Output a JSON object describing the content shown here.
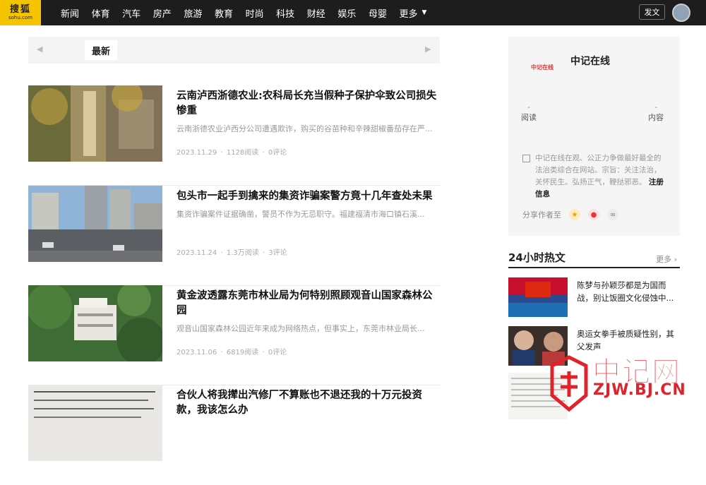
{
  "brand": {
    "logo_line1": "搜狐",
    "logo_line2": "sohu.com"
  },
  "nav": {
    "items": [
      "新闻",
      "体育",
      "汽车",
      "房产",
      "旅游",
      "教育",
      "时尚",
      "科技",
      "财经",
      "娱乐",
      "母婴"
    ],
    "more_label": "更多",
    "publish_label": "发文"
  },
  "tabs": {
    "active": "最新"
  },
  "articles": [
    {
      "title": "云南泸西浙德农业:农科局长充当假种子保护伞致公司损失惨重",
      "summary": "云南浙德农业泸西分公司遭遇欺诈，购买的谷苗种和辛辣甜椒番茄存在严...",
      "date": "2023.11.29",
      "reads": "1128阅读",
      "comments": "0评论"
    },
    {
      "title": "包头市一起手到擒来的集资诈骗案警方竟十几年查处未果",
      "summary": "集资诈骗案件证据确凿，警员不作为无忌职守。福建福清市海口镇石溪...",
      "date": "2023.11.24",
      "reads": "1.3万阅读",
      "comments": "3评论"
    },
    {
      "title": "黄金波透露东莞市林业局为何特别照顾观音山国家森林公园",
      "summary": "观音山国家森林公园近年来成为网络热点，但事实上，东莞市林业局长...",
      "date": "2023.11.06",
      "reads": "6819阅读",
      "comments": "0评论"
    },
    {
      "title": "合伙人将我撵出汽修厂不算账也不退还我的十万元投资款，我该怎么办",
      "summary": "",
      "date": "",
      "reads": "",
      "comments": ""
    }
  ],
  "profile": {
    "logo_text": "中记在线",
    "name": "中记在线",
    "stats": [
      {
        "value": "-",
        "label": "阅读"
      },
      {
        "value": "-",
        "label": "内容"
      }
    ],
    "description": "中记在线在观、公正力争做最好最全的法治类综合在网站。宗旨：关注法治，关怀民生。弘扬正气，鞭挞邪恶。",
    "register_label": "注册信息",
    "share_label": "分享作者至"
  },
  "hot": {
    "title": "24小时热文",
    "more_label": "更多",
    "items": [
      {
        "text": "陈梦与孙颖莎都是为国而战，别让饭圈文化侵蚀中..."
      },
      {
        "text": "奥运女拳手被质疑性别，其父发声"
      },
      {
        "text": ""
      }
    ]
  },
  "watermark": {
    "cn": "中记网",
    "en": "ZJW.BJ.CN"
  }
}
